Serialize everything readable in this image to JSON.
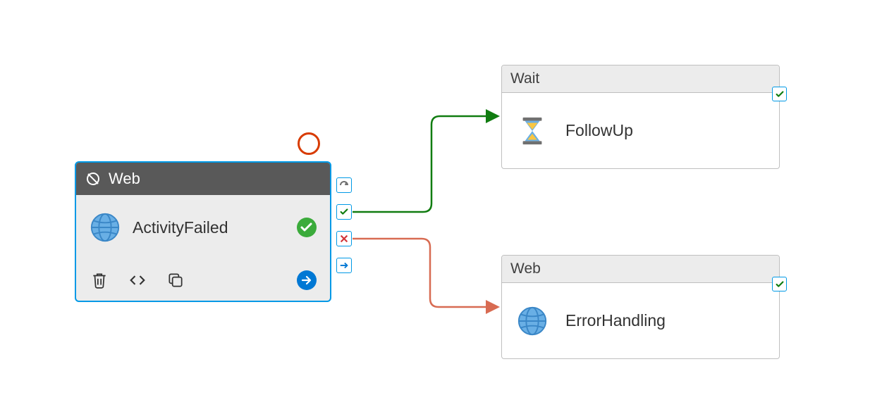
{
  "activities": {
    "main": {
      "type_label": "Web",
      "name": "ActivityFailed",
      "status": "succeeded",
      "icons": {
        "eye_off": "eye-off-icon",
        "globe": "globe-icon",
        "status": "check-circle-icon",
        "delete": "trash-icon",
        "code": "code-icon",
        "copy": "copy-icon",
        "run": "arrow-right-circle-icon"
      }
    },
    "followup": {
      "type_label": "Wait",
      "name": "FollowUp",
      "icon": "hourglass-icon",
      "validated": true
    },
    "errorhandling": {
      "type_label": "Web",
      "name": "ErrorHandling",
      "icon": "globe-icon",
      "validated": true
    }
  },
  "connectors": {
    "handles": {
      "completion": "completion-handle",
      "success": "success-handle",
      "failure": "failure-handle",
      "skip": "skip-handle"
    },
    "edges": [
      {
        "from": "main",
        "to": "followup",
        "type": "success",
        "color": "#107c10"
      },
      {
        "from": "main",
        "to": "errorhandling",
        "type": "failure",
        "color": "#d86b52"
      }
    ]
  },
  "breakpoint": {
    "set": true
  }
}
